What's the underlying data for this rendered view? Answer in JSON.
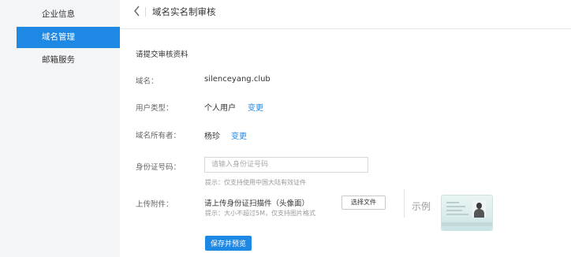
{
  "sidebar": {
    "items": [
      {
        "label": "企业信息",
        "active": false
      },
      {
        "label": "域名管理",
        "active": true
      },
      {
        "label": "邮箱服务",
        "active": false
      }
    ]
  },
  "header": {
    "back_icon": "chevron-left-icon",
    "title": "域名实名制审核"
  },
  "form": {
    "section_title": "请提交审核资料",
    "domain": {
      "label": "域名：",
      "value": "silenceyang.club"
    },
    "user_type": {
      "label": "用户类型：",
      "value": "个人用户",
      "link": "变更"
    },
    "owner": {
      "label": "域名所有者：",
      "value": "杨珍",
      "link": "变更"
    },
    "id_number": {
      "label": "身份证号码：",
      "value": "",
      "placeholder": "请输入身份证号码",
      "hint": "提示：仅支持使用中国大陆有效证件"
    },
    "attachment": {
      "label": "上传附件：",
      "instruction": "请上传身份证扫描件（头像面）",
      "hint": "提示：大小不超过5M，仅支持图片格式",
      "button": "选择文件",
      "example_label": "示例"
    },
    "submit": "保存并预览"
  },
  "colors": {
    "accent": "#1e88e5",
    "sidebar_bg": "#f4f5f7",
    "label_text": "#666666",
    "hint_text": "#999999"
  }
}
